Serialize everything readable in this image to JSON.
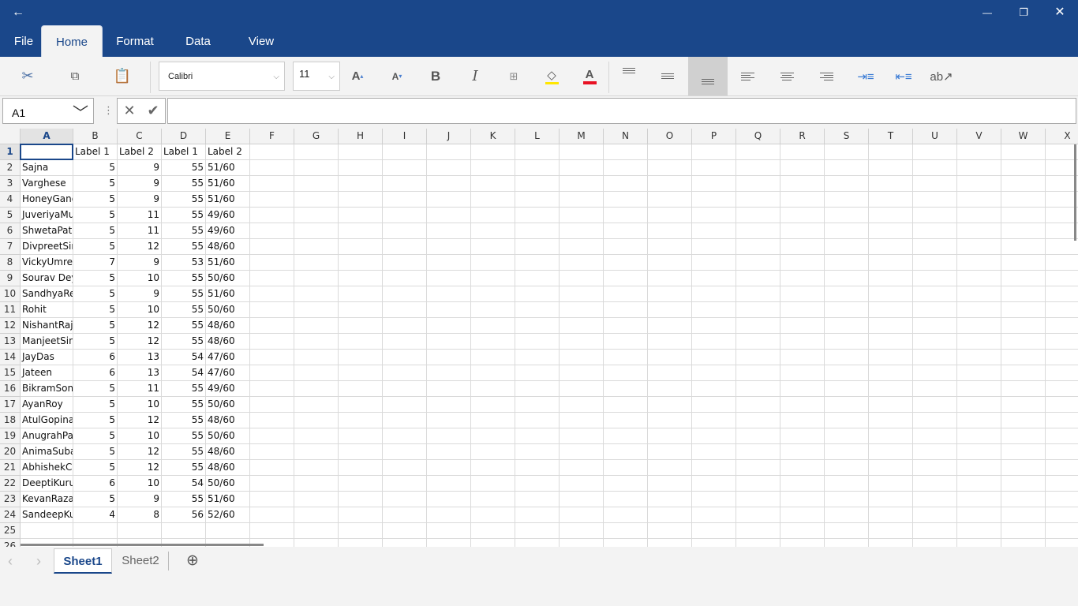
{
  "titlebar": {
    "back": "←",
    "minimize": "—",
    "restore": "❐",
    "close": "✕"
  },
  "tabs": [
    {
      "label": "File"
    },
    {
      "label": "Home",
      "active": true
    },
    {
      "label": "Format"
    },
    {
      "label": "Data"
    },
    {
      "label": "View"
    }
  ],
  "ribbon": {
    "font": "Calibri",
    "font_size": "11",
    "fill_color": "#ffe600",
    "font_color": "#e81123",
    "selected_alignment": "align-bottom"
  },
  "formula_bar": {
    "name_box": "A1",
    "formula": ""
  },
  "grid": {
    "columns": [
      "A",
      "B",
      "C",
      "D",
      "E",
      "F",
      "G",
      "H",
      "I",
      "J",
      "K",
      "L",
      "M",
      "N",
      "O",
      "P",
      "Q",
      "R",
      "S",
      "T",
      "U",
      "V",
      "W",
      "X"
    ],
    "active_cell": "A1",
    "rows": [
      [
        "",
        "Label 1",
        "Label 2",
        "Label 1",
        "Label 2"
      ],
      [
        "Sajna",
        "5",
        "9",
        "55",
        "51/60"
      ],
      [
        "Varghese",
        "5",
        "9",
        "55",
        "51/60"
      ],
      [
        "HoneyGang",
        "5",
        "9",
        "55",
        "51/60"
      ],
      [
        "JuveriyaMu",
        "5",
        "11",
        "55",
        "49/60"
      ],
      [
        "ShwetaPate",
        "5",
        "11",
        "55",
        "49/60"
      ],
      [
        "DivpreetSin",
        "5",
        "12",
        "55",
        "48/60"
      ],
      [
        "VickyUmrek",
        "7",
        "9",
        "53",
        "51/60"
      ],
      [
        "Sourav Dey",
        "5",
        "10",
        "55",
        "50/60"
      ],
      [
        "SandhyaRer",
        "5",
        "9",
        "55",
        "51/60"
      ],
      [
        "Rohit",
        "5",
        "10",
        "55",
        "50/60"
      ],
      [
        "NishantRajp",
        "5",
        "12",
        "55",
        "48/60"
      ],
      [
        "ManjeetSin",
        "5",
        "12",
        "55",
        "48/60"
      ],
      [
        "JayDas",
        "6",
        "13",
        "54",
        "47/60"
      ],
      [
        "Jateen",
        "6",
        "13",
        "54",
        "47/60"
      ],
      [
        "BikramSoni",
        "5",
        "11",
        "55",
        "49/60"
      ],
      [
        "AyanRoy",
        "5",
        "10",
        "55",
        "50/60"
      ],
      [
        "AtulGopinat",
        "5",
        "12",
        "55",
        "48/60"
      ],
      [
        "AnugrahPar",
        "5",
        "10",
        "55",
        "50/60"
      ],
      [
        "AnimaSuba",
        "5",
        "12",
        "55",
        "48/60"
      ],
      [
        "AbhishekCh",
        "5",
        "12",
        "55",
        "48/60"
      ],
      [
        "DeeptiKuru",
        "6",
        "10",
        "54",
        "50/60"
      ],
      [
        "KevanRaza",
        "5",
        "9",
        "55",
        "51/60"
      ],
      [
        "SandeepKui",
        "4",
        "8",
        "56",
        "52/60"
      ],
      [],
      []
    ]
  },
  "sheets": [
    {
      "label": "Sheet1",
      "active": true
    },
    {
      "label": "Sheet2"
    }
  ]
}
